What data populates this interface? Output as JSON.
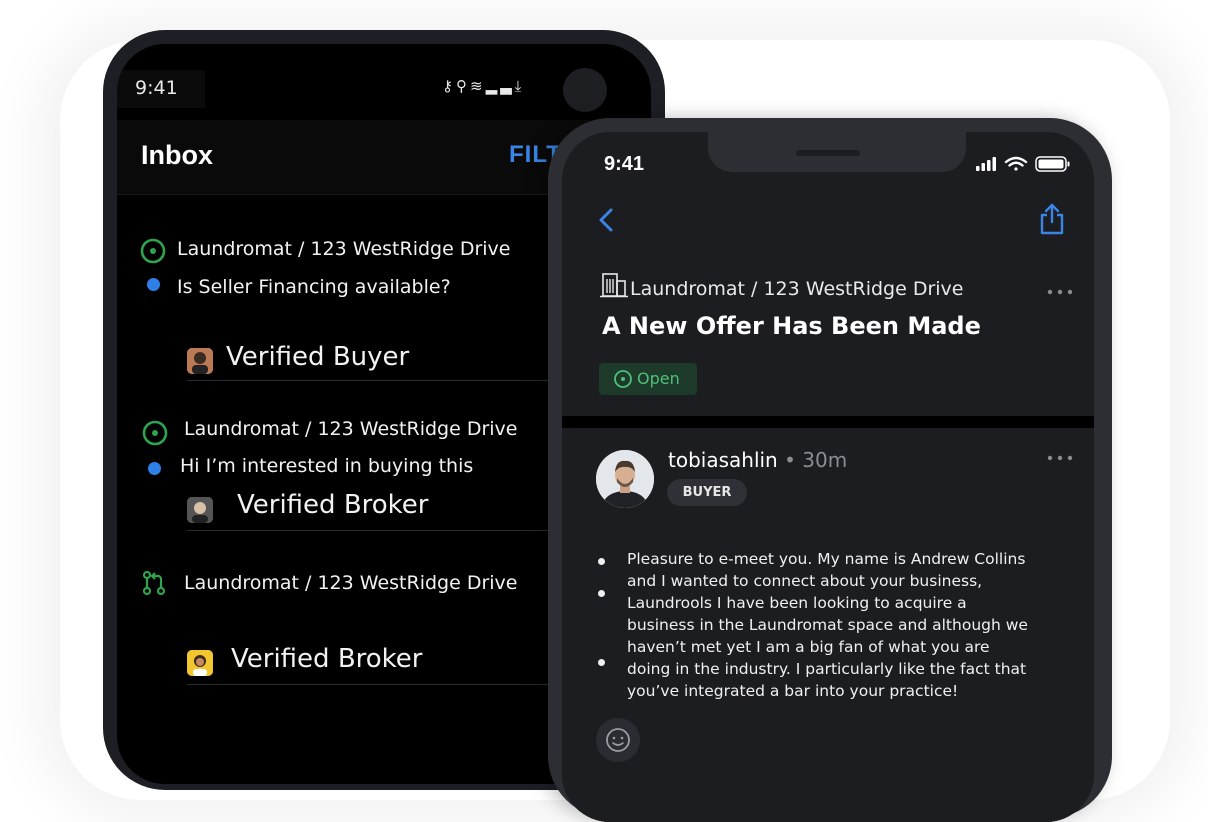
{
  "inbox_phone": {
    "status_time": "9:41",
    "title": "Inbox",
    "filter_label": "FILT",
    "threads": [
      {
        "subject": "Laundromat / 123 WestRidge Drive",
        "snippet": "Is Seller Financing available?",
        "role": "Verified Buyer",
        "status_icon": "open-issue-icon"
      },
      {
        "subject": "Laundromat / 123 WestRidge Drive",
        "snippet": "Hi I’m interested in buying this",
        "role": "Verified Broker",
        "status_icon": "open-issue-icon"
      },
      {
        "subject": "Laundromat / 123 WestRidge Drive",
        "snippet": "",
        "role": "Verified Broker",
        "status_icon": "pull-request-icon"
      }
    ]
  },
  "detail_phone": {
    "status_time": "9:41",
    "listing": "Laundromat / 123 WestRidge Drive",
    "title": "A New Offer Has Been Made",
    "status_badge": "Open",
    "comment": {
      "author": "tobiasahlin",
      "separator": " • ",
      "time_ago": "30m",
      "role_badge": "BUYER",
      "body": "Pleasure to e-meet you. My name is Andrew Collins and I wanted to connect about your business, Laundrools I have been looking to acquire a business in the Laundromat space and although we haven’t met yet I am a big fan of what you are doing in the industry. I particularly like the fact that you’ve integrated a bar into your practice!"
    }
  },
  "colors": {
    "accent_blue": "#3a84e6",
    "open_green": "#4fc07a",
    "unread_dot": "#2f7fe8",
    "icon_green": "#2ea44f"
  }
}
